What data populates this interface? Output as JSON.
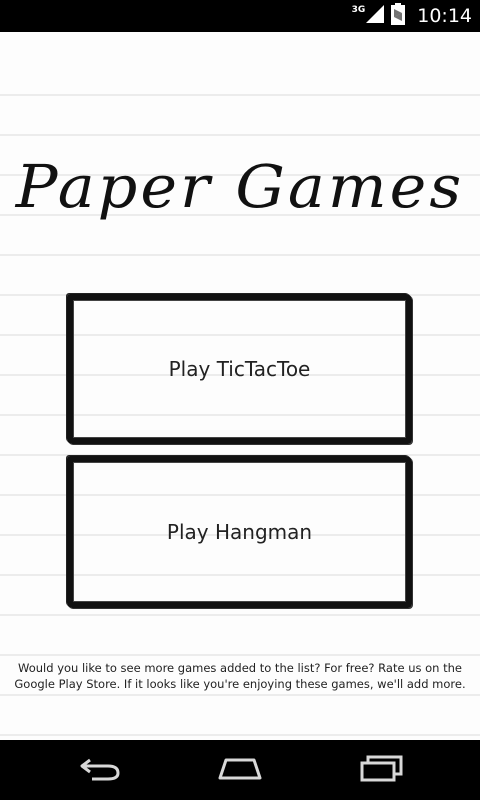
{
  "status_bar": {
    "network_type": "3G",
    "time": "10:14",
    "icons": [
      "signal-icon",
      "battery-icon"
    ]
  },
  "app": {
    "title": "Paper Games",
    "buttons": {
      "tictactoe": "Play TicTacToe",
      "hangman": "Play Hangman"
    },
    "footer_text": "Would you like to see more games added to the list? For free? Rate us on the Google Play Store. If it looks like you're enjoying these games, we'll add more."
  },
  "nav_bar": {
    "icons": [
      "back-icon",
      "home-icon",
      "recent-apps-icon"
    ]
  },
  "colors": {
    "paper_background": "#fdfdfd",
    "paper_lines": "#ececec",
    "ink": "#111111",
    "system_bars": "#000000"
  }
}
